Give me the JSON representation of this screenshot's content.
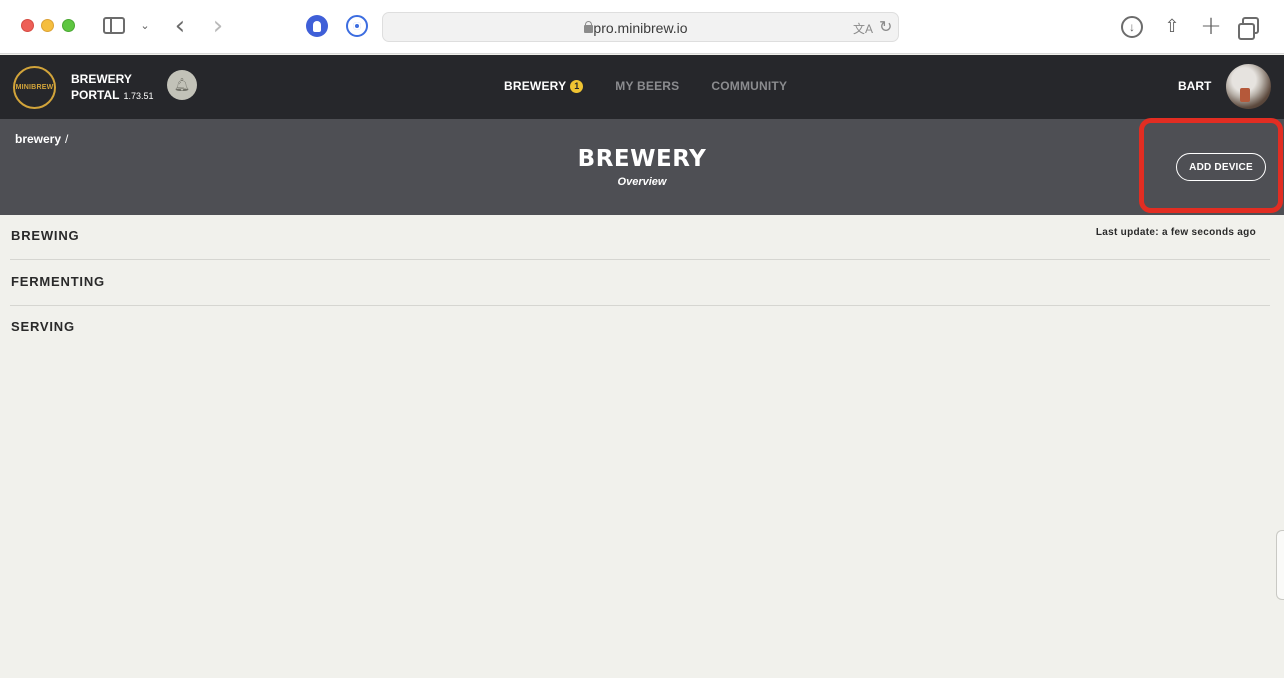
{
  "browser": {
    "url": "pro.minibrew.io",
    "icons": [
      "sidebar-icon",
      "chevron-down-icon",
      "back-icon",
      "forward-icon",
      "extension-hand-icon",
      "password-manager-icon",
      "lock-icon",
      "translate-icon",
      "reload-icon",
      "download-icon",
      "share-icon",
      "new-tab-icon",
      "tabs-overview-icon"
    ]
  },
  "app": {
    "logo_text": "MINIBREW",
    "portal_title_line1": "BREWERY",
    "portal_title_line2": "PORTAL",
    "version": "1.73.51",
    "nav": [
      {
        "label": "BREWERY",
        "badge": "1",
        "active": true
      },
      {
        "label": "MY BEERS",
        "active": false
      },
      {
        "label": "COMMUNITY",
        "active": false
      }
    ],
    "user_name": "BART",
    "colors": {
      "header_bg": "#26272b",
      "subheader_bg": "#4e4f54",
      "content_bg": "#f1f1ec",
      "badge": "#f0c432",
      "highlight": "#e22d22"
    }
  },
  "page": {
    "breadcrumb": "brewery",
    "breadcrumb_sep": "/",
    "title": "BREWERY",
    "subtitle": "Overview",
    "add_device_label": "ADD DEVICE",
    "last_update": "Last update: a few seconds ago",
    "sections": [
      "BREWING",
      "FERMENTING",
      "SERVING"
    ]
  }
}
